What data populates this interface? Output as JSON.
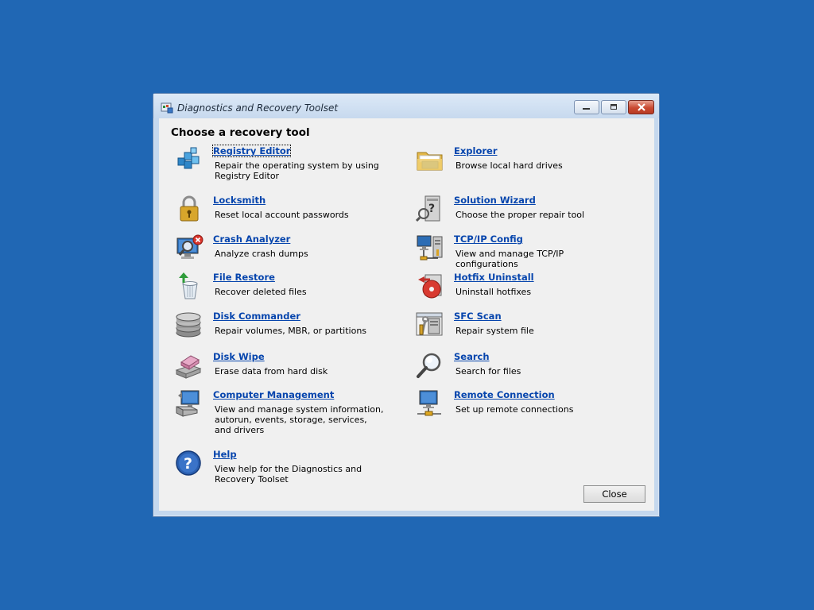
{
  "window": {
    "title": "Diagnostics and Recovery Toolset",
    "title_icon": "dart-app-icon"
  },
  "heading": "Choose a recovery tool",
  "tools": [
    {
      "name": "Registry Editor",
      "description": "Repair the operating system by using Registry Editor",
      "icon": "registry-editor-icon"
    },
    {
      "name": "Explorer",
      "description": "Browse local hard drives",
      "icon": "explorer-folder-icon"
    },
    {
      "name": "Locksmith",
      "description": "Reset local account passwords",
      "icon": "padlock-icon"
    },
    {
      "name": "Solution Wizard",
      "description": "Choose the proper repair tool",
      "icon": "solution-wizard-icon"
    },
    {
      "name": "Crash Analyzer",
      "description": "Analyze crash dumps",
      "icon": "crash-analyzer-icon"
    },
    {
      "name": "TCP/IP Config",
      "description": "View and manage TCP/IP configurations",
      "icon": "tcpip-config-icon"
    },
    {
      "name": "File Restore",
      "description": "Recover deleted files",
      "icon": "recycle-bin-restore-icon"
    },
    {
      "name": "Hotfix Uninstall",
      "description": "Uninstall hotfixes",
      "icon": "hotfix-uninstall-icon"
    },
    {
      "name": "Disk Commander",
      "description": "Repair volumes, MBR, or partitions",
      "icon": "disk-stack-icon"
    },
    {
      "name": "SFC Scan",
      "description": "Repair system file",
      "icon": "sfc-scan-icon"
    },
    {
      "name": "Disk Wipe",
      "description": "Erase data from hard disk",
      "icon": "disk-wipe-icon"
    },
    {
      "name": "Search",
      "description": "Search for files",
      "icon": "magnifier-icon"
    },
    {
      "name": "Computer Management",
      "description": "View and manage system information, autorun, events, storage, services, and drivers",
      "icon": "computer-management-icon"
    },
    {
      "name": "Remote Connection",
      "description": "Set up remote connections",
      "icon": "remote-connection-icon"
    },
    {
      "name": "Help",
      "description": "View help for the Diagnostics and Recovery Toolset",
      "icon": "help-icon"
    }
  ],
  "buttons": {
    "close": "Close"
  },
  "colors": {
    "desktop": "#2067b4",
    "link": "#0645ad",
    "client_background": "#f0f0f0"
  }
}
